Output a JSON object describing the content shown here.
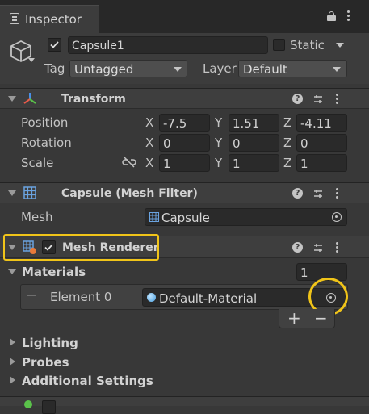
{
  "tab": {
    "title": "Inspector"
  },
  "object": {
    "name": "Capsule1",
    "static_label": "Static",
    "tag_label": "Tag",
    "tag_value": "Untagged",
    "layer_label": "Layer",
    "layer_value": "Default"
  },
  "transform": {
    "title": "Transform",
    "rows": [
      {
        "label": "Position",
        "x": "-7.5",
        "y": "1.51",
        "z": "-4.11"
      },
      {
        "label": "Rotation",
        "x": "0",
        "y": "0",
        "z": "0"
      },
      {
        "label": "Scale",
        "x": "1",
        "y": "1",
        "z": "1"
      }
    ],
    "axis": {
      "x": "X",
      "y": "Y",
      "z": "Z"
    }
  },
  "mesh_filter": {
    "title": "Capsule (Mesh Filter)",
    "mesh_label": "Mesh",
    "mesh_value": "Capsule"
  },
  "mesh_renderer": {
    "title": "Mesh Renderer",
    "materials_label": "Materials",
    "materials_count": "1",
    "element_label": "Element 0",
    "element_value": "Default-Material",
    "plus": "+",
    "minus": "−",
    "subsections": [
      "Lighting",
      "Probes",
      "Additional Settings"
    ]
  },
  "colors": {
    "highlight": "#f0c419"
  }
}
